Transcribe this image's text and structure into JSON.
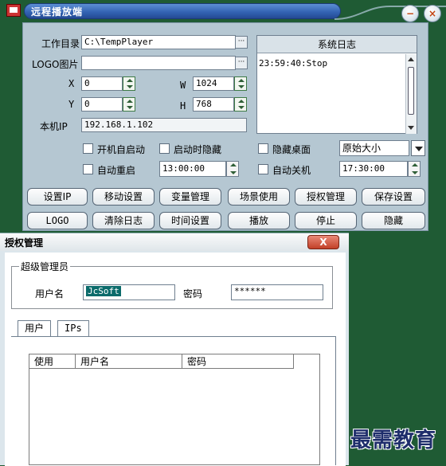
{
  "main": {
    "title": "远程播放端",
    "labels": {
      "workdir": "工作目录",
      "logo_image": "LOGO图片",
      "x": "X",
      "y": "Y",
      "w": "W",
      "h": "H",
      "local_ip": "本机IP"
    },
    "fields": {
      "workdir": "C:\\TempPlayer",
      "logo_image": "",
      "x": "0",
      "y": "0",
      "w": "1024",
      "h": "768",
      "local_ip": "192.168.1.102",
      "restart_time": "13:00:00",
      "shutdown_time": "17:30:00",
      "size_select": "原始大小"
    },
    "dots": "···",
    "log": {
      "header": "系统日志",
      "lines": [
        "23:59:40:Stop"
      ]
    },
    "checkboxes": {
      "autostart": "开机自启动",
      "hide_on_start": "启动时隐藏",
      "hide_desktop": "隐藏桌面",
      "auto_restart": "自动重启",
      "auto_shutdown": "自动关机"
    },
    "buttons_row1": [
      "设置IP",
      "移动设置",
      "变量管理",
      "场景使用",
      "授权管理",
      "保存设置"
    ],
    "buttons_row2": [
      "LOGO",
      "清除日志",
      "时间设置",
      "播放",
      "停止",
      "隐藏"
    ],
    "window_buttons": {
      "minimize": "−",
      "close": "×"
    }
  },
  "dialog": {
    "title": "授权管理",
    "close": "X",
    "group_title": "超级管理员",
    "username_label": "用户名",
    "username_value": "JcSoft",
    "password_label": "密码",
    "password_value": "******",
    "tabs": [
      "用户",
      "IPs"
    ],
    "columns": [
      "使用",
      "用户名",
      "密码"
    ]
  },
  "watermark": "最需教育",
  "colors": {
    "desktop": "#1f5b34",
    "title_blue": "#3161b1",
    "panel": "#b5c7d2"
  }
}
